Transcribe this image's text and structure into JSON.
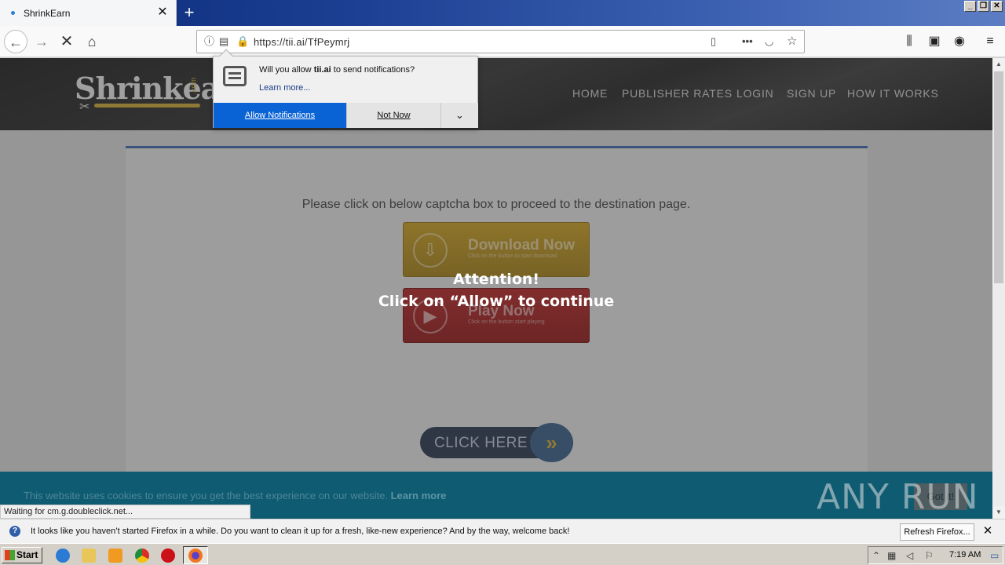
{
  "browser": {
    "tab_title": "ShrinkEarn",
    "url": "https://tii.ai/TfPeymrj",
    "status_text": "Waiting for cm.g.doubleclick.net..."
  },
  "notification_popup": {
    "question_prefix": "Will you allow ",
    "domain": "tii.ai",
    "question_suffix": " to send notifications?",
    "learn_more": "Learn more...",
    "allow_label": "Allow Notifications",
    "not_now_label": "Not Now"
  },
  "site": {
    "logo_text": "Shrinkearn",
    "logo_suffix": ".com",
    "nav": [
      "HOME",
      "PUBLISHER RATES",
      "LOGIN",
      "SIGN UP",
      "HOW IT WORKS"
    ],
    "captcha_prompt": "Please click on below captcha box to proceed to the destination page.",
    "download_button": {
      "title": "Download Now",
      "subtitle": "Click on the button to start download"
    },
    "play_button": {
      "title": "Play Now",
      "subtitle": "Click on the button start playing"
    },
    "click_here_label": "CLICK HERE",
    "attention_title": "Attention!",
    "attention_text": "Click on “Allow” to continue",
    "cookie_text": "This website uses cookies to ensure you get the best experience on our website.",
    "cookie_learn_more": "Learn more",
    "cookie_button": "Got it!"
  },
  "watermark": "ANY RUN",
  "infobar": {
    "message": "It looks like you haven’t started Firefox in a while. Do you want to clean it up for a fresh, like-new experience? And by the way, welcome back!",
    "refresh_label": "Refresh Firefox..."
  },
  "taskbar": {
    "start_label": "Start",
    "clock": "7:19 AM"
  },
  "colors": {
    "allow_blue": "#0a63d4",
    "cookie_bar": "#0e5b72",
    "download_gold": "#c99a14",
    "play_red": "#b31818"
  }
}
